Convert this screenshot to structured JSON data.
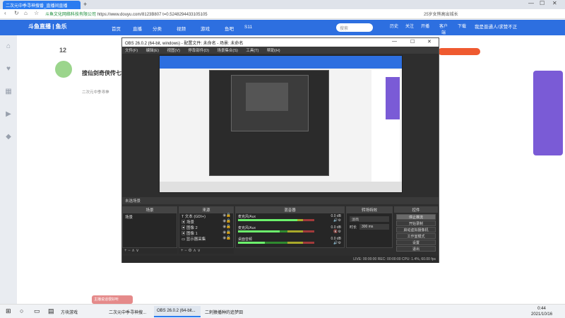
{
  "browser": {
    "tab_title": "二次元中季寻神搜番_直播间直播",
    "new_tab": "+",
    "url_prefix": "斗鱼文化网络科技有限公司",
    "url": "https://www.douyu.com/8123B807 t=0.5248294433105105",
    "right_text": "25岁女熊高出城长",
    "window_controls": [
      "—",
      "☐",
      "✕"
    ]
  },
  "site": {
    "logo": "斗鱼直播 | 鱼乐",
    "nav": [
      "首页",
      "直播",
      "分类",
      "视频",
      "游戏",
      "鱼吧",
      "S11"
    ],
    "search_placeholder": "搜索",
    "header_icons": [
      "历史",
      "关注",
      "开播",
      "客户端",
      "下载"
    ],
    "user": "我是普通人/求赞不正"
  },
  "page": {
    "count": "12",
    "streamer_title": "搜仙剑奇侠传七!",
    "streamer_sub": "二次元中季寻神",
    "chat_bubble": "主播说话很好听"
  },
  "obs": {
    "title": "OBS 26.0.2 (64-bit, windows) - 配置文件: 未命名 - 场景: 未命名",
    "menu": [
      "文件(F)",
      "编辑(E)",
      "视图(V)",
      "停靠部件(D)",
      "场景集合(S)",
      "工具(T)",
      "帮助(H)"
    ],
    "scene_label": "未选场景",
    "docks": {
      "scenes": "场景",
      "sources": "来源",
      "mixer": "混音器",
      "transitions": "转场特效",
      "controls": "控件"
    },
    "scenes": [
      "场景"
    ],
    "sources": [
      {
        "name": "文本 (GDI+)",
        "icon": "T"
      },
      {
        "name": "场景",
        "icon": "▣"
      },
      {
        "name": "图像 2",
        "icon": "▣"
      },
      {
        "name": "图像 1",
        "icon": "▣"
      },
      {
        "name": "显示器采集",
        "icon": "▭"
      }
    ],
    "mixer": [
      {
        "name": "麦克风/Aux",
        "db": "0.0 dB",
        "level": 0.78
      },
      {
        "name": "麦克风/Aux",
        "db": "0.0 dB",
        "level": 0.55
      },
      {
        "name": "桌面音频",
        "db": "0.0 dB",
        "level": 0.35
      }
    ],
    "transition": {
      "type": "淡出",
      "duration_label": "时长",
      "duration": "300 ms"
    },
    "controls": [
      "停止推流",
      "开始录制",
      "启动虚拟摄像机",
      "工作室模式",
      "设置",
      "退出"
    ],
    "status": "LIVE: 00:00:00   REC: 00:00:00   CPU: 1.4%, 60.00 fps"
  },
  "taskbar": {
    "items": [
      "",
      "",
      "",
      "",
      "方块游戏",
      "二次元中季寻神搜...",
      "OBS 26.0.2 (64-bit...",
      "二刺猿播种的追梦田"
    ],
    "time": "0:44",
    "date": "2021/10/16"
  },
  "colors": {
    "accent": "#2d6fe0",
    "obs_bg": "#2e2e2e",
    "tab_active": "#2b7cf0"
  }
}
